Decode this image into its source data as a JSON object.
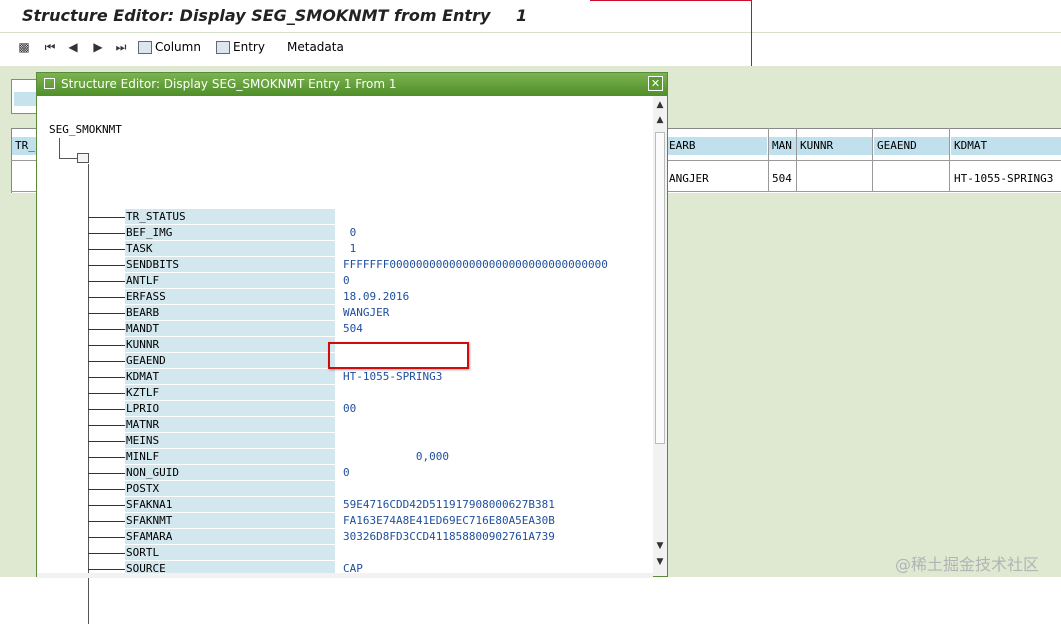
{
  "window": {
    "title": "Structure Editor: Display SEG_SMOKNMT from Entry",
    "entry_number": "1"
  },
  "toolbar": {
    "column_label": "Column",
    "entry_label": "Entry",
    "metadata_label": "Metadata"
  },
  "background_table": {
    "headers": [
      "TR_",
      "EARB",
      "MAN",
      "KUNNR",
      "GEAEND",
      "KDMAT"
    ],
    "row": [
      "",
      "ANGJER",
      "504",
      "",
      "",
      "HT-1055-SPRING3"
    ]
  },
  "dialog": {
    "title": "Structure Editor: Display SEG_SMOKNMT Entry 1 From 1",
    "close_symbol": "✕",
    "root": "SEG_SMOKNMT",
    "fields": [
      {
        "name": "TR_STATUS",
        "value": ""
      },
      {
        "name": "BEF_IMG",
        "value": " 0"
      },
      {
        "name": "TASK",
        "value": " 1"
      },
      {
        "name": "SENDBITS",
        "value": "FFFFFFF000000000000000000000000000000000"
      },
      {
        "name": "ANTLF",
        "value": "0"
      },
      {
        "name": "ERFASS",
        "value": "18.09.2016"
      },
      {
        "name": "BEARB",
        "value": "WANGJER"
      },
      {
        "name": "MANDT",
        "value": "504"
      },
      {
        "name": "KUNNR",
        "value": ""
      },
      {
        "name": "GEAEND",
        "value": ""
      },
      {
        "name": "KDMAT",
        "value": "HT-1055-SPRING3"
      },
      {
        "name": "KZTLF",
        "value": ""
      },
      {
        "name": "LPRIO",
        "value": "00"
      },
      {
        "name": "MATNR",
        "value": ""
      },
      {
        "name": "MEINS",
        "value": ""
      },
      {
        "name": "MINLF",
        "value": "           0,000"
      },
      {
        "name": "NON_GUID",
        "value": "0"
      },
      {
        "name": "POSTX",
        "value": ""
      },
      {
        "name": "SFAKNA1",
        "value": "59E4716CDD42D511917908000627B381"
      },
      {
        "name": "SFAKNMT",
        "value": "FA163E74A8E41ED69EC716E80A5EA30B"
      },
      {
        "name": "SFAMARA",
        "value": "30326D8FD3CCD411858800902761A739"
      },
      {
        "name": "SORTL",
        "value": ""
      },
      {
        "name": "SOURCE",
        "value": "CAP"
      }
    ]
  },
  "watermark": "@稀土掘金技术社区",
  "colors": {
    "dialog_title_bar": "#5a9a2f",
    "field_label_bg": "#d2e7ee",
    "value_text": "#1e4f9e",
    "highlight": "#d20a0a"
  }
}
